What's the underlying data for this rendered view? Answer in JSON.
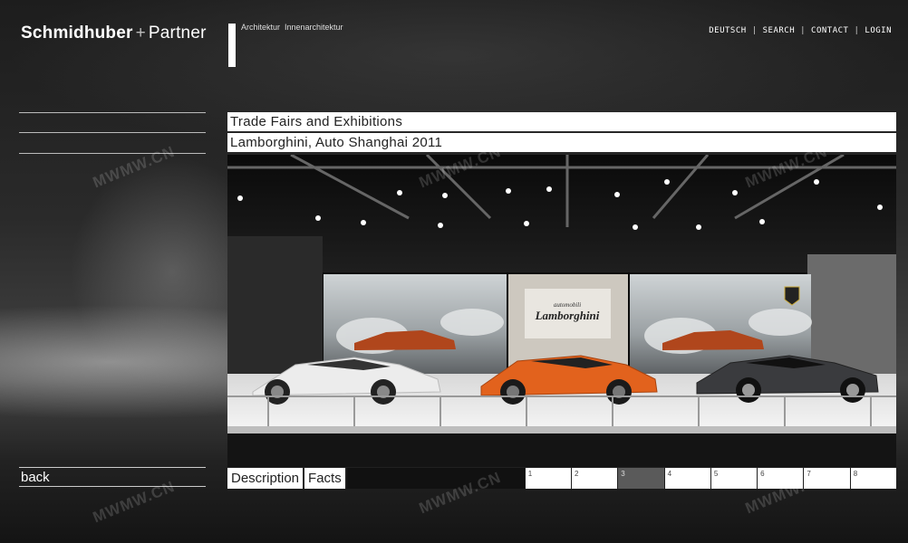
{
  "brand": {
    "name_bold": "Schmidhuber",
    "plus": "+",
    "name_light": "Partner",
    "tagline": [
      "Architektur",
      "Innenarchitektur"
    ]
  },
  "topnav": [
    "DEUTSCH",
    "SEARCH",
    "CONTACT",
    "LOGIN"
  ],
  "nav_separator": "|",
  "sidebar": {
    "back_label": "back"
  },
  "project": {
    "category": "Trade Fairs and Exhibitions",
    "title": "Lamborghini, Auto Shanghai 2011"
  },
  "photo_content": {
    "backwall_brand_small": "automobili",
    "backwall_brand": "Lamborghini"
  },
  "bottom_tabs": [
    "Description",
    "Facts"
  ],
  "pagination": {
    "pages": [
      "1",
      "2",
      "3",
      "4",
      "5",
      "6",
      "7",
      "8"
    ],
    "active_index": 2
  },
  "watermark": "MWMW.CN",
  "colors": {
    "bar_white": "#ffffff",
    "active_page": "#5a5a5a",
    "car_white": "#e8e8e8",
    "car_orange": "#e2621d",
    "car_dark": "#3a3b3e"
  }
}
